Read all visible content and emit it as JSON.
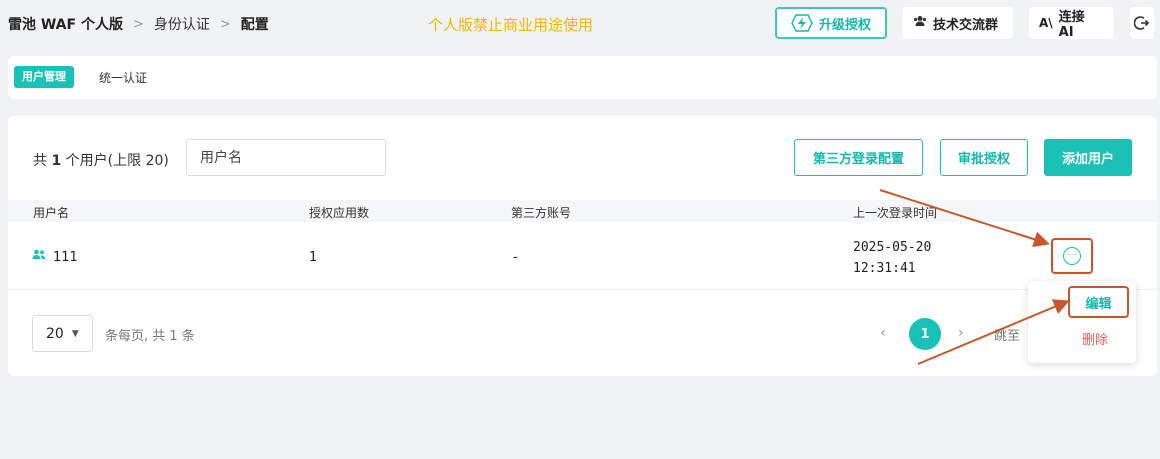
{
  "breadcrumb": {
    "app": "雷池 WAF 个人版",
    "section": "身份认证",
    "current": "配置",
    "separator": ">"
  },
  "notice": "个人版禁止商业用途使用",
  "top_buttons": {
    "upgrade": "升级授权",
    "group": "技术交流群",
    "ai": "连接 AI"
  },
  "icons": {
    "upgrade": "lightning-icon",
    "group": "users-icon",
    "ai": "ai-icon",
    "logout": "logout-icon",
    "user": "user-group-icon",
    "more": "more-icon"
  },
  "tabs": [
    {
      "label": "用户管理",
      "active": true
    },
    {
      "label": "统一认证",
      "active": false
    }
  ],
  "toolbar": {
    "count_prefix": "共",
    "count_value": "1",
    "count_suffix": "个用户(上限 20)",
    "search_placeholder": "用户名",
    "thirdparty_btn": "第三方登录配置",
    "approve_btn": "审批授权",
    "add_btn": "添加用户"
  },
  "table": {
    "columns": [
      "用户名",
      "授权应用数",
      "第三方账号",
      "上一次登录时间"
    ],
    "rows": [
      {
        "username": "111",
        "apps": "1",
        "third_party": "-",
        "last_login_date": "2025-05-20",
        "last_login_time": "12:31:41"
      }
    ]
  },
  "pagination": {
    "page_size": "20",
    "info": "条每页, 共 1 条",
    "current_page": "1",
    "jump_label": "跳至",
    "prev": "‹",
    "next": "›"
  },
  "row_menu": {
    "edit": "编辑",
    "delete": "删除"
  },
  "colors": {
    "accent": "#19c1b6",
    "notice": "#f5b400",
    "highlight": "#c8552b",
    "danger": "#f05c5c"
  }
}
